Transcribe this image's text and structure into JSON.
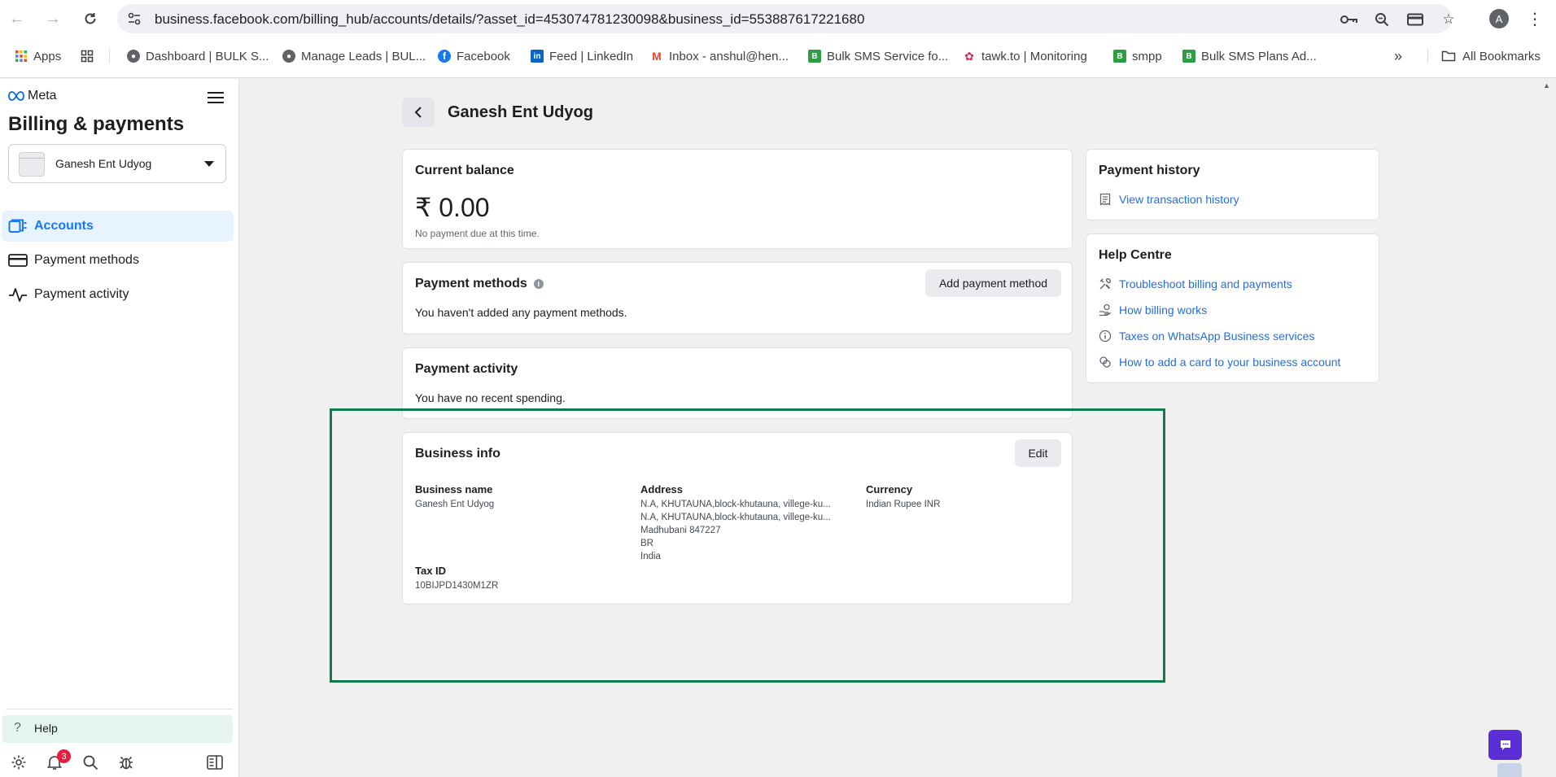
{
  "browser": {
    "url": "business.facebook.com/billing_hub/accounts/details/?asset_id=453074781230098&business_id=553887617221680",
    "avatar_initial": "A",
    "bookmarks": [
      {
        "label": "Apps"
      },
      {
        "label": "Dashboard | BULK S..."
      },
      {
        "label": "Manage Leads | BUL..."
      },
      {
        "label": "Facebook"
      },
      {
        "label": "Feed | LinkedIn"
      },
      {
        "label": "Inbox - anshul@hen..."
      },
      {
        "label": "Bulk SMS Service fo..."
      },
      {
        "label": "tawk.to | Monitoring"
      },
      {
        "label": "smpp"
      },
      {
        "label": "Bulk SMS Plans Ad..."
      }
    ],
    "overflow_label": "»",
    "all_bookmarks_label": "All Bookmarks"
  },
  "sidebar": {
    "logo_text": "Meta",
    "title": "Billing & payments",
    "account_name": "Ganesh Ent Udyog",
    "items": [
      {
        "label": "Accounts",
        "icon": "accounts-icon",
        "active": true
      },
      {
        "label": "Payment methods",
        "icon": "card-icon",
        "active": false
      },
      {
        "label": "Payment activity",
        "icon": "activity-icon",
        "active": false
      }
    ],
    "help_label": "Help",
    "notification_count": "3"
  },
  "main": {
    "page_title": "Ganesh Ent Udyog",
    "balance": {
      "title": "Current balance",
      "amount": "₹ 0.00",
      "note": "No payment due at this time."
    },
    "payment_methods": {
      "title": "Payment methods",
      "add_button": "Add payment method",
      "empty_text": "You haven't added any payment methods."
    },
    "payment_activity": {
      "title": "Payment activity",
      "empty_text": "You have no recent spending."
    },
    "business_info": {
      "title": "Business info",
      "edit_button": "Edit",
      "business_name_label": "Business name",
      "business_name": "Ganesh Ent Udyog",
      "address_label": "Address",
      "address_lines": [
        "N.A, KHUTAUNA,block-khutauna, villege-ku...",
        "N.A, KHUTAUNA,block-khutauna, villege-ku...",
        "Madhubani 847227",
        "BR",
        "India"
      ],
      "currency_label": "Currency",
      "currency": "Indian Rupee INR",
      "tax_id_label": "Tax ID",
      "tax_id": "10BIJPD1430M1ZR"
    },
    "payment_history": {
      "title": "Payment history",
      "link": "View transaction history"
    },
    "help_centre": {
      "title": "Help Centre",
      "links": [
        "Troubleshoot billing and payments",
        "How billing works",
        "Taxes on WhatsApp Business services",
        "How to add a card to your business account"
      ]
    }
  },
  "colors": {
    "link": "#216fdb",
    "accent": "#1877f2",
    "highlight_border": "#0f7a4c",
    "chat_button": "#5b2ed6"
  }
}
